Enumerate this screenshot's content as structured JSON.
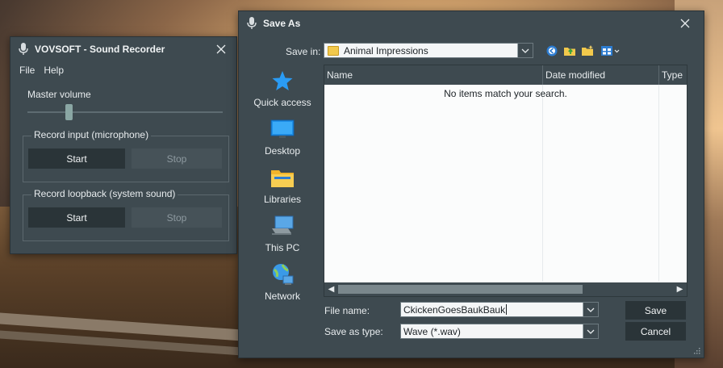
{
  "recorder": {
    "title": "VOVSOFT - Sound Recorder",
    "menu": {
      "file": "File",
      "help": "Help"
    },
    "master_volume_label": "Master volume",
    "master_volume": 0.2,
    "record_input": {
      "legend": "Record input (microphone)",
      "start": "Start",
      "stop": "Stop"
    },
    "record_loopback": {
      "legend": "Record loopback (system sound)",
      "start": "Start",
      "stop": "Stop"
    }
  },
  "save_dialog": {
    "title": "Save As",
    "save_in_label": "Save in:",
    "save_in_value": "Animal Impressions",
    "toolbar_icons": [
      "back-icon",
      "up-folder-icon",
      "new-folder-icon",
      "view-menu-icon"
    ],
    "places": [
      {
        "label": "Quick access",
        "icon": "star-icon"
      },
      {
        "label": "Desktop",
        "icon": "desktop-icon"
      },
      {
        "label": "Libraries",
        "icon": "libraries-icon"
      },
      {
        "label": "This PC",
        "icon": "this-pc-icon"
      },
      {
        "label": "Network",
        "icon": "network-icon"
      }
    ],
    "columns": {
      "name": "Name",
      "date_modified": "Date modified",
      "type": "Type"
    },
    "empty_message": "No items match your search.",
    "file_name_label": "File name:",
    "file_name_value": "CkickenGoesBaukBauk",
    "save_as_type_label": "Save as type:",
    "save_as_type_value": "Wave (*.wav)",
    "save_button": "Save",
    "cancel_button": "Cancel"
  },
  "colors": {
    "window_bg": "#3e4a50",
    "button_dark": "#2a3438",
    "accent_blue": "#1e90ff"
  }
}
